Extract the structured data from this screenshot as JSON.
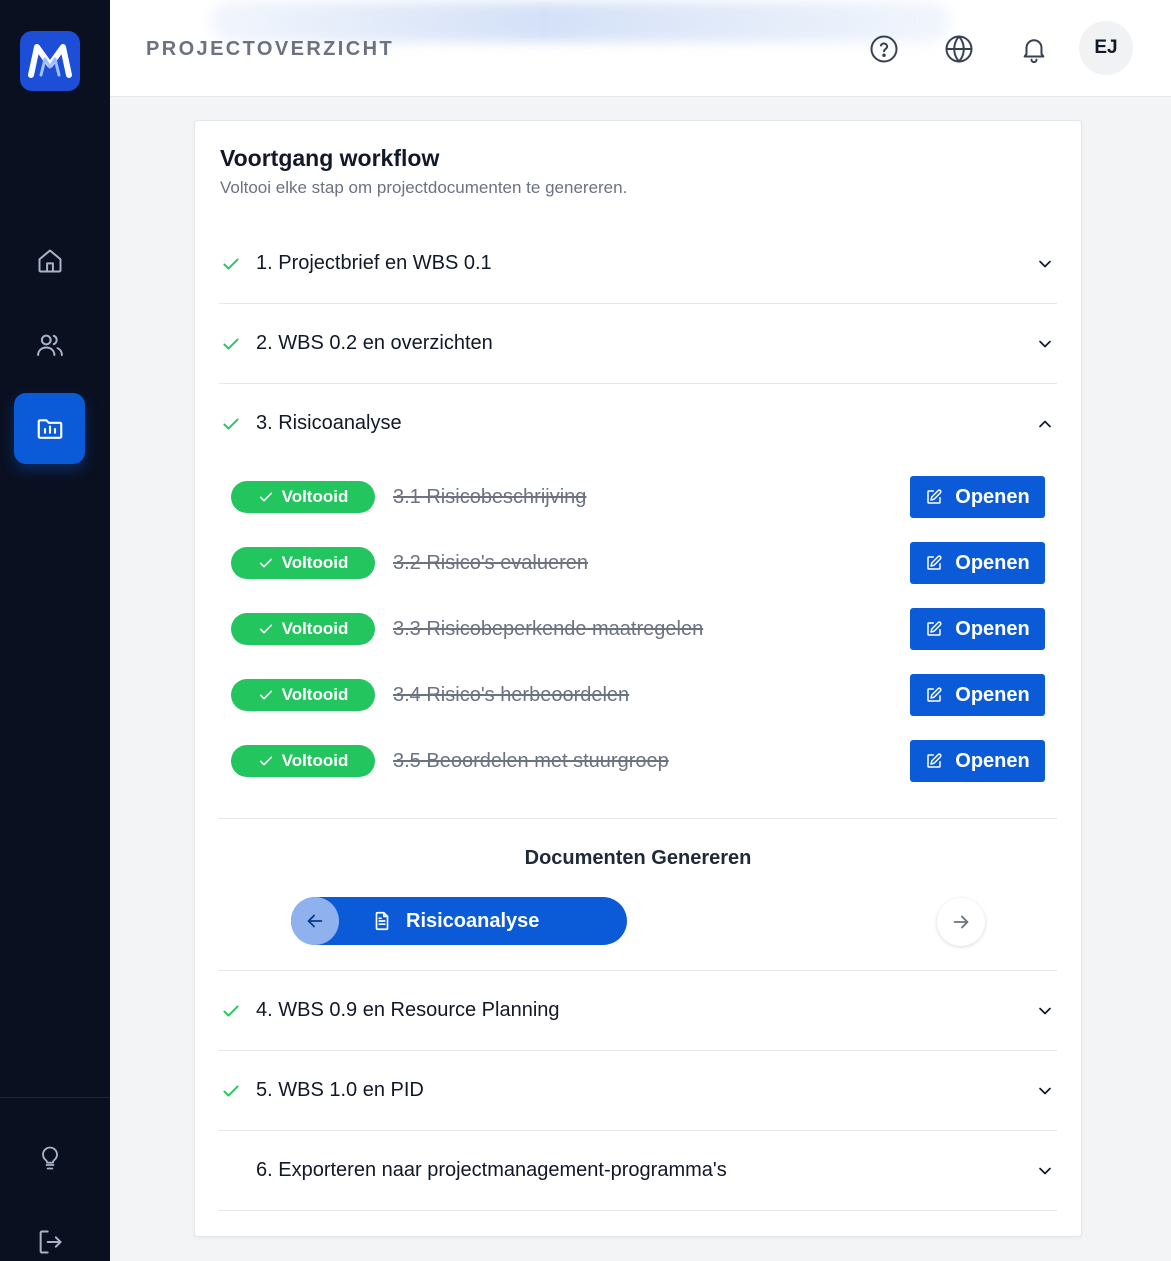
{
  "header": {
    "title": "PROJECTOVERZICHT",
    "avatar_initials": "EJ",
    "icons": [
      "help-icon",
      "globe-icon",
      "bell-icon"
    ]
  },
  "sidebar": {
    "logo": "M",
    "items": [
      {
        "name": "home",
        "icon": "home-icon"
      },
      {
        "name": "users",
        "icon": "users-icon"
      },
      {
        "name": "projects",
        "icon": "folder-chart-icon",
        "active": true
      }
    ],
    "bottom_items": [
      {
        "name": "tips",
        "icon": "lightbulb-icon"
      },
      {
        "name": "logout",
        "icon": "logout-icon"
      }
    ]
  },
  "card": {
    "title": "Voortgang workflow",
    "subtitle": "Voltooi elke stap om projectdocumenten te genereren."
  },
  "steps": [
    {
      "label": "1. Projectbrief en WBS 0.1",
      "completed": true,
      "expanded": false
    },
    {
      "label": "2. WBS 0.2 en overzichten",
      "completed": true,
      "expanded": false
    },
    {
      "label": "3. Risicoanalyse",
      "completed": true,
      "expanded": true
    },
    {
      "label": "4. WBS 0.9 en Resource Planning",
      "completed": true,
      "expanded": false
    },
    {
      "label": "5. WBS 1.0 en PID",
      "completed": true,
      "expanded": false
    },
    {
      "label": "6. Exporteren naar projectmanagement-programma's",
      "completed": false,
      "expanded": false
    }
  ],
  "substeps": [
    {
      "badge": "Voltooid",
      "label": "3.1 Risicobeschrijving",
      "button": "Openen"
    },
    {
      "badge": "Voltooid",
      "label": "3.2 Risico's evalueren",
      "button": "Openen"
    },
    {
      "badge": "Voltooid",
      "label": "3.3 Risicobeperkende maatregelen",
      "button": "Openen"
    },
    {
      "badge": "Voltooid",
      "label": "3.4 Risico's herbeoordelen",
      "button": "Openen"
    },
    {
      "badge": "Voltooid",
      "label": "3.5 Beoordelen met stuurgroep",
      "button": "Openen"
    }
  ],
  "documents": {
    "title": "Documenten Genereren",
    "current": "Risicoanalyse"
  },
  "colors": {
    "accent": "#0b5bd8",
    "success": "#22c55e",
    "sidebar_bg": "#0a1020"
  }
}
